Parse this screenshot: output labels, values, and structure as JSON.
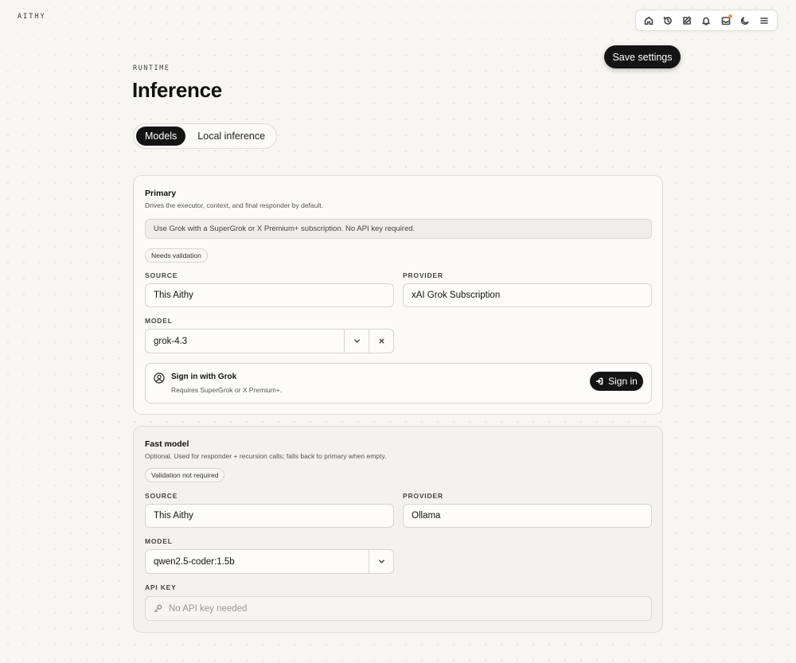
{
  "brand": "AITHY",
  "nav": {
    "icons": [
      "home-icon",
      "history-icon",
      "edit-icon",
      "bell-icon",
      "inbox-icon",
      "moon-icon",
      "menu-icon"
    ],
    "notification_color": "#e8a13a"
  },
  "header": {
    "eyebrow": "RUNTIME",
    "title": "Inference",
    "save_label": "Save settings"
  },
  "tabs": [
    {
      "label": "Models",
      "active": true
    },
    {
      "label": "Local inference",
      "active": false
    }
  ],
  "primary": {
    "title": "Primary",
    "description": "Drives the executor, context, and final responder by default.",
    "info": "Use Grok with a SuperGrok or X Premium+ subscription. No API key required.",
    "badge": "Needs validation",
    "source_label": "SOURCE",
    "source_value": "This Aithy",
    "provider_label": "PROVIDER",
    "provider_value": "xAI Grok Subscription",
    "model_label": "MODEL",
    "model_value": "grok-4.3",
    "signin": {
      "title": "Sign in with Grok",
      "subtitle": "Requires SuperGrok or X Premium+.",
      "button_label": "Sign in"
    }
  },
  "fast": {
    "title": "Fast model",
    "description": "Optional. Used for responder + recursion calls; falls back to primary when empty.",
    "badge": "Validation not required",
    "source_label": "SOURCE",
    "source_value": "This Aithy",
    "provider_label": "PROVIDER",
    "provider_value": "Ollama",
    "model_label": "MODEL",
    "model_value": "qwen2.5-coder:1.5b",
    "api_key_label": "API KEY",
    "api_key_placeholder": "No API key needed"
  },
  "colors": {
    "accent": "#141414",
    "background": "#f7f6f2"
  }
}
